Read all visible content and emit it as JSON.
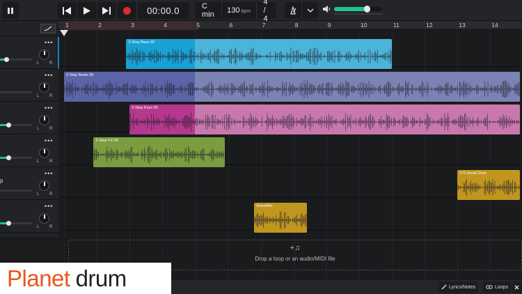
{
  "transport": {
    "time": "00:00.0",
    "key": "C min",
    "tempo": "130",
    "tempo_unit": "bpm",
    "meter": "4 / 4",
    "volume_percent": 70
  },
  "ruler": {
    "bars": [
      "1",
      "2",
      "3",
      "4",
      "5",
      "6",
      "7",
      "8",
      "9",
      "10",
      "11",
      "12",
      "13",
      "14"
    ]
  },
  "tracks": [
    {
      "name": "",
      "fader_percent": 20
    },
    {
      "name": "",
      "fader_percent": 0
    },
    {
      "name": "",
      "fader_percent": 25
    },
    {
      "name": "",
      "fader_percent": 25
    },
    {
      "name": "p",
      "fader_percent": 0
    },
    {
      "name": "",
      "fader_percent": 25
    }
  ],
  "knob_labels": {
    "left": "L",
    "right": "R"
  },
  "clips": [
    {
      "label": "2-Step Bass 02",
      "color": "#1aa0d3",
      "loop_color": "#4cb3d9"
    },
    {
      "label": "2-Step Beats 00",
      "color": "#5b64a6",
      "loop_color": "#7a83b4"
    },
    {
      "label": "2-Step Keys 06",
      "color": "#b5388e",
      "loop_color": "#c978ad"
    },
    {
      "label": "2-Step FX 05",
      "color": "#7a9d3f",
      "loop_color": "#7a9d3f"
    },
    {
      "label": "2-S Vocal Chop",
      "color": "#c0961f",
      "loop_color": "#c0961f"
    },
    {
      "label": "Voice/Mic",
      "color": "#c0961f",
      "loop_color": "#c0961f"
    }
  ],
  "drop_zone": {
    "icon": "+♫",
    "text": "Drop a loop or an audio/MIDI file"
  },
  "bottom": {
    "lyrics_label": "Lyrics/Notes",
    "loops_label": "Loops"
  },
  "logo": {
    "part1": "Planet",
    "part2": "drum"
  }
}
